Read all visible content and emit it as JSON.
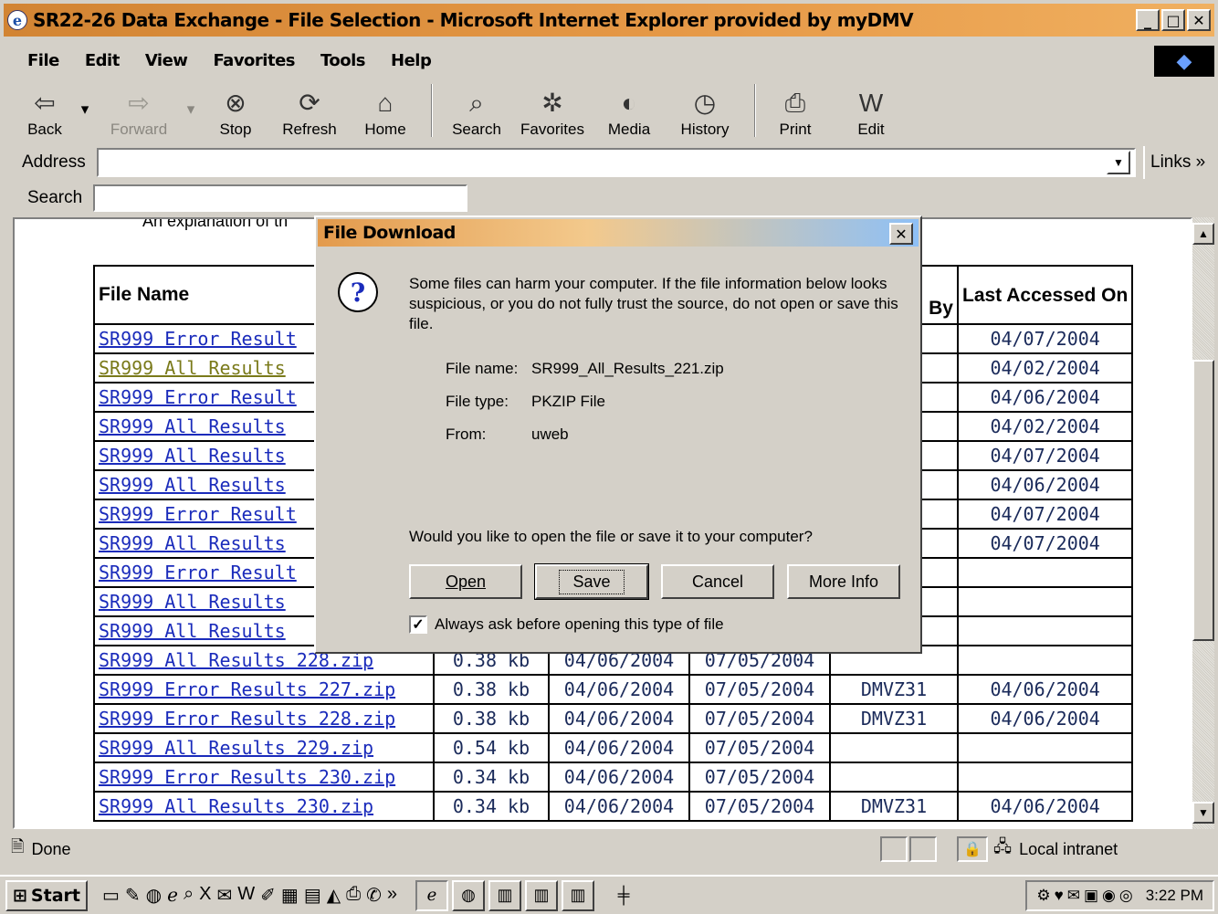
{
  "window": {
    "title": "SR22-26 Data Exchange - File Selection - Microsoft Internet Explorer provided by myDMV"
  },
  "menu": [
    "File",
    "Edit",
    "View",
    "Favorites",
    "Tools",
    "Help"
  ],
  "toolbar": {
    "back": "Back",
    "forward": "Forward",
    "stop": "Stop",
    "refresh": "Refresh",
    "home": "Home",
    "search": "Search",
    "favorites": "Favorites",
    "media": "Media",
    "history": "History",
    "print": "Print",
    "edit": "Edit"
  },
  "address": {
    "label": "Address",
    "value": "",
    "links": "Links »"
  },
  "searchbar": {
    "label": "Search",
    "value": ""
  },
  "page": {
    "intro_fragment": "An explanation of th"
  },
  "table": {
    "headers": {
      "file_name": "File Name",
      "by": "By",
      "last_accessed": "Last Accessed On"
    },
    "rows": [
      {
        "name": "SR999 Error Result",
        "accessed": "04/07/2004"
      },
      {
        "name": "SR999 All Results",
        "accessed": "04/02/2004"
      },
      {
        "name": "SR999 Error Result",
        "accessed": "04/06/2004"
      },
      {
        "name": "SR999 All Results",
        "accessed": "04/02/2004"
      },
      {
        "name": "SR999 All Results",
        "accessed": "04/07/2004"
      },
      {
        "name": "SR999 All Results",
        "accessed": "04/06/2004"
      },
      {
        "name": "SR999 Error Result",
        "accessed": "04/07/2004"
      },
      {
        "name": "SR999 All Results",
        "accessed": "04/07/2004"
      },
      {
        "name": "SR999 Error Result",
        "accessed": ""
      },
      {
        "name": "SR999 All Results",
        "accessed": ""
      },
      {
        "name": "SR999 All Results",
        "accessed": ""
      },
      {
        "name": "SR999 All Results 228.zip",
        "size": "0.38 kb",
        "created": "04/06/2004",
        "expires": "07/05/2004",
        "by": "",
        "accessed": ""
      },
      {
        "name": "SR999 Error Results 227.zip",
        "size": "0.38 kb",
        "created": "04/06/2004",
        "expires": "07/05/2004",
        "by": "DMVZ31",
        "accessed": "04/06/2004"
      },
      {
        "name": "SR999 Error Results 228.zip",
        "size": "0.38 kb",
        "created": "04/06/2004",
        "expires": "07/05/2004",
        "by": "DMVZ31",
        "accessed": "04/06/2004"
      },
      {
        "name": "SR999 All Results 229.zip",
        "size": "0.54 kb",
        "created": "04/06/2004",
        "expires": "07/05/2004",
        "by": "",
        "accessed": ""
      },
      {
        "name": "SR999 Error Results 230.zip",
        "size": "0.34 kb",
        "created": "04/06/2004",
        "expires": "07/05/2004",
        "by": "",
        "accessed": ""
      },
      {
        "name": "SR999 All Results 230.zip",
        "size": "0.34 kb",
        "created": "04/06/2004",
        "expires": "07/05/2004",
        "by": "DMVZ31",
        "accessed": "04/06/2004"
      }
    ]
  },
  "dialog": {
    "title": "File Download",
    "warning": "Some files can harm your computer. If the file information below looks suspicious, or you do not fully trust the source, do not open or save this file.",
    "file_name_label": "File name:",
    "file_name": "SR999_All_Results_221.zip",
    "file_type_label": "File type:",
    "file_type": "PKZIP File",
    "from_label": "From:",
    "from": "uweb",
    "question": "Would you like to open the file or save it to your computer?",
    "buttons": {
      "open": "Open",
      "save": "Save",
      "cancel": "Cancel",
      "more_info": "More Info"
    },
    "checkbox_label": "Always ask before opening this type of file",
    "checkbox_checked": true
  },
  "status": {
    "text": "Done",
    "zone": "Local intranet"
  },
  "taskbar": {
    "start": "Start",
    "clock": "3:22 PM"
  }
}
